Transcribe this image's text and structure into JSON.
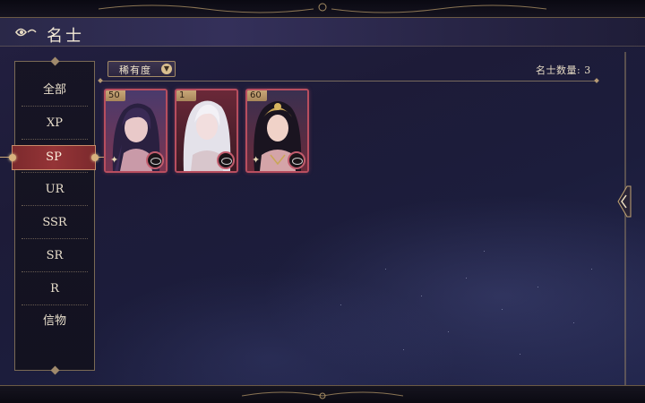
{
  "header": {
    "title": "名士"
  },
  "categories": [
    {
      "label": "全部",
      "active": false
    },
    {
      "label": "XP",
      "active": false
    },
    {
      "label": "SP",
      "active": true
    },
    {
      "label": "UR",
      "active": false
    },
    {
      "label": "SSR",
      "active": false
    },
    {
      "label": "SR",
      "active": false
    },
    {
      "label": "R",
      "active": false
    },
    {
      "label": "信物",
      "active": false
    }
  ],
  "toolbar": {
    "sort_label": "稀有度",
    "count_text": "名士数量: 3"
  },
  "cards": [
    {
      "level": "50",
      "icon": "purple-haired-character-portrait"
    },
    {
      "level": "1",
      "icon": "white-haired-character-portrait"
    },
    {
      "level": "60",
      "icon": "black-haired-character-portrait"
    }
  ],
  "colors": {
    "accent_red": "#953437",
    "gold": "#c9a676",
    "card_border": "#b84e5f",
    "background": "#1d1b38"
  }
}
